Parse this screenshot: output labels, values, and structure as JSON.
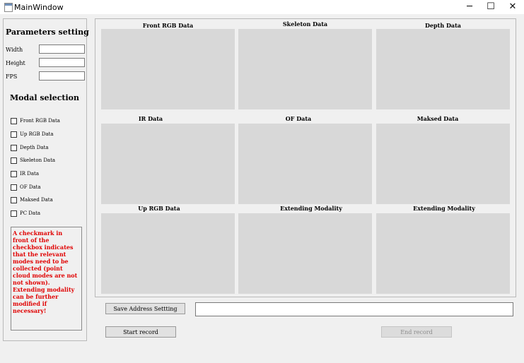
{
  "window": {
    "title": "MainWindow",
    "minimize_glyph": "─",
    "maximize_glyph": "☐",
    "close_glyph": "✕"
  },
  "params": {
    "title": "Parameters setting",
    "width_label": "Width",
    "height_label": "Height",
    "fps_label": "FPS",
    "width_value": "",
    "height_value": "",
    "fps_value": ""
  },
  "modal": {
    "title": "Modal selection",
    "checkboxes": [
      {
        "label": "Front RGB Data",
        "checked": false
      },
      {
        "label": "Up RGB Data",
        "checked": false
      },
      {
        "label": "Depth Data",
        "checked": false
      },
      {
        "label": "Skeleton Data",
        "checked": false
      },
      {
        "label": "IR Data",
        "checked": false
      },
      {
        "label": "OF Data",
        "checked": false
      },
      {
        "label": "Maksed Data",
        "checked": false
      },
      {
        "label": "PC Data",
        "checked": false
      }
    ],
    "note": "A checkmark in front of the checkbox indicates that the relevant modes need to be collected (point cloud modes are not not shown). Extending modality can be further modified if necessary!"
  },
  "grid": {
    "cells": [
      {
        "title": "Front RGB Data"
      },
      {
        "title": "Skeleton Data"
      },
      {
        "title": "Depth Data"
      },
      {
        "title": "IR Data"
      },
      {
        "title": "OF Data"
      },
      {
        "title": "Maksed Data"
      },
      {
        "title": "Up RGB Data"
      },
      {
        "title": "Extending Modality"
      },
      {
        "title": "Extending Modality"
      }
    ]
  },
  "actions": {
    "save_address_label": "Save Address Settting",
    "address_value": "",
    "start_label": "Start record",
    "end_label": "End record"
  },
  "colors": {
    "note_text": "#e00000",
    "cell_background": "#d8d8d8",
    "window_background": "#f0f0f0"
  }
}
